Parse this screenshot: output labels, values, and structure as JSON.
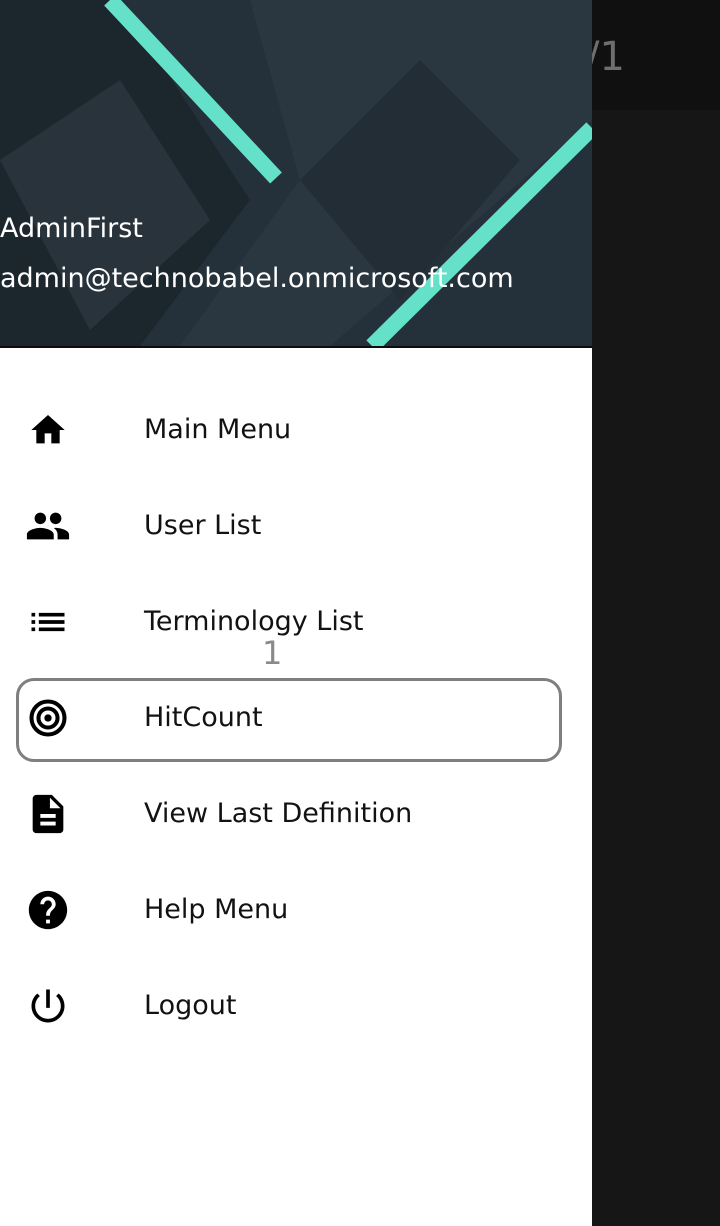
{
  "background": {
    "title_fragment": "/1"
  },
  "drawer": {
    "header": {
      "user_name": "AdminFirst",
      "user_email": "admin@technobabel.onmicrosoft.com",
      "accent_color": "#64e1c8"
    },
    "items": [
      {
        "label": "Main Menu",
        "icon": "home-icon"
      },
      {
        "label": "User List",
        "icon": "people-icon"
      },
      {
        "label": "Terminology List",
        "icon": "list-icon"
      },
      {
        "label": "HitCount",
        "icon": "target-icon"
      },
      {
        "label": "View Last Definition",
        "icon": "document-icon"
      },
      {
        "label": "Help Menu",
        "icon": "help-icon"
      },
      {
        "label": "Logout",
        "icon": "power-icon"
      }
    ]
  },
  "highlight": {
    "index_label": "1",
    "target": "HitCount"
  }
}
